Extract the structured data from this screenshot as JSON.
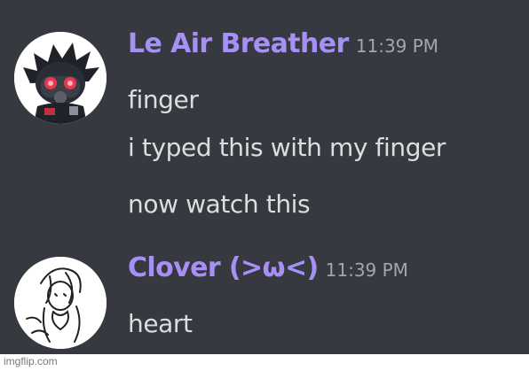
{
  "messages": [
    {
      "username": "Le Air Breather",
      "timestamp": "11:39 PM",
      "lines": [
        "finger",
        "i typed this with my finger",
        "now watch this"
      ]
    },
    {
      "username": "Clover (>ω<)",
      "timestamp": "11:39 PM",
      "lines": [
        "heart"
      ]
    }
  ],
  "watermark": "imgflip.com",
  "colors": {
    "background": "#36393f",
    "username": "#a690f6",
    "timestamp": "#a3a6aa",
    "message_text": "#dcddde"
  },
  "icons": [
    "user-avatar-masked-character",
    "user-avatar-sketch-character"
  ]
}
